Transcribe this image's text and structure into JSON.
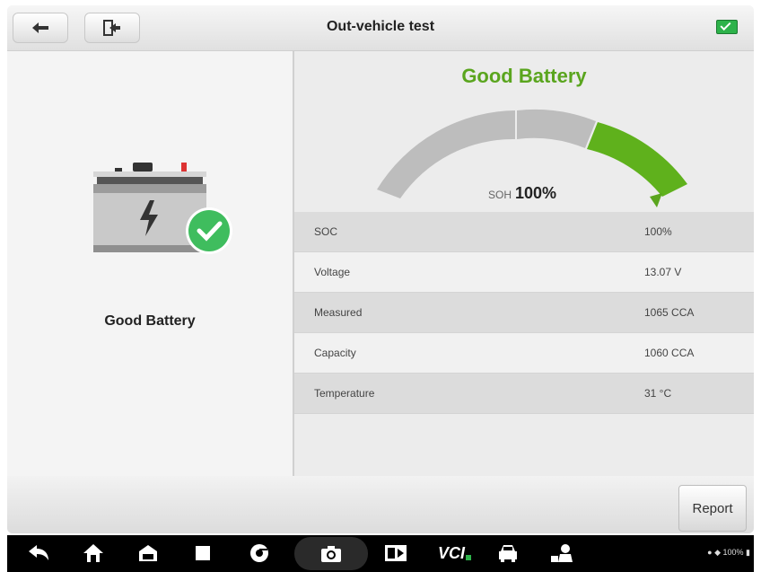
{
  "header": {
    "title": "Out-vehicle test"
  },
  "left_panel": {
    "status_label": "Good Battery"
  },
  "gauge": {
    "headline": "Good Battery",
    "soh_label": "SOH",
    "soh_value": "100%",
    "soh_percent": 100
  },
  "results": [
    {
      "label": "SOC",
      "value": "100%"
    },
    {
      "label": "Voltage",
      "value": "13.07 V"
    },
    {
      "label": "Measured",
      "value": "1065 CCA"
    },
    {
      "label": "Capacity",
      "value": "1060 CCA"
    },
    {
      "label": "Temperature",
      "value": "31 °C"
    }
  ],
  "footer": {
    "report_label": "Report"
  },
  "taskbar": {
    "vci_label": "VCI",
    "status_text": "100%",
    "icons": [
      "back-icon",
      "home-icon",
      "garage-icon",
      "recent-apps-icon",
      "chrome-icon",
      "camera-icon",
      "screen-record-icon",
      "vci-icon",
      "vehicle-icon",
      "mechanic-icon"
    ]
  },
  "colors": {
    "good": "#5aa51e",
    "gauge_green": "#5fb11c",
    "gauge_gray": "#bdbdbd"
  }
}
